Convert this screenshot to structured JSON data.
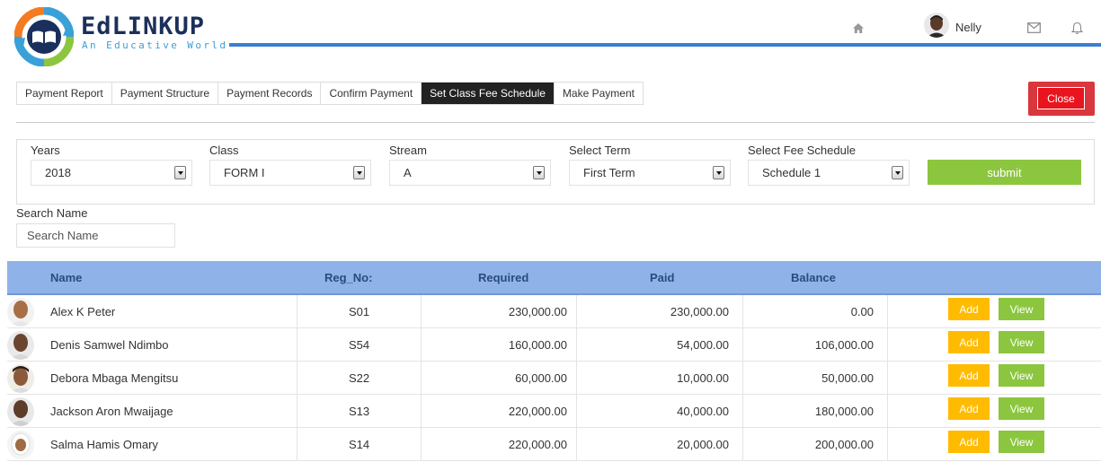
{
  "header": {
    "brand": "EdLINKUP",
    "tagline": "An Educative World",
    "user_name": "Nelly"
  },
  "tabs": [
    {
      "label": "Payment Report"
    },
    {
      "label": "Payment Structure"
    },
    {
      "label": "Payment Records"
    },
    {
      "label": "Confirm Payment"
    },
    {
      "label": "Set Class Fee Schedule",
      "active": true
    },
    {
      "label": "Make Payment"
    }
  ],
  "close_label": "Close",
  "filters": {
    "years": {
      "label": "Years",
      "value": "2018"
    },
    "class": {
      "label": "Class",
      "value": "FORM I"
    },
    "stream": {
      "label": "Stream",
      "value": "A"
    },
    "term": {
      "label": "Select Term",
      "value": "First Term"
    },
    "schedule": {
      "label": "Select Fee Schedule",
      "value": "Schedule 1"
    },
    "submit_label": "submit"
  },
  "search": {
    "label": "Search Name",
    "placeholder": "Search Name"
  },
  "table": {
    "columns": [
      "Name",
      "Reg_No:",
      "Required",
      "Paid",
      "Balance"
    ],
    "add_label": "Add",
    "view_label": "View",
    "rows": [
      {
        "name": "Alex K Peter",
        "reg_no": "S01",
        "required": "230,000.00",
        "paid": "230,000.00",
        "balance": "0.00"
      },
      {
        "name": "Denis Samwel Ndimbo",
        "reg_no": "S54",
        "required": "160,000.00",
        "paid": "54,000.00",
        "balance": "106,000.00"
      },
      {
        "name": "Debora Mbaga Mengitsu",
        "reg_no": "S22",
        "required": "60,000.00",
        "paid": "10,000.00",
        "balance": "50,000.00"
      },
      {
        "name": "Jackson Aron Mwaijage",
        "reg_no": "S13",
        "required": "220,000.00",
        "paid": "40,000.00",
        "balance": "180,000.00"
      },
      {
        "name": "Salma Hamis Omary",
        "reg_no": "S14",
        "required": "220,000.00",
        "paid": "20,000.00",
        "balance": "200,000.00"
      }
    ]
  },
  "colors": {
    "brand_navy": "#1b2f5c",
    "accent_blue": "#3b7fd1",
    "header_row": "#8fb3e8",
    "green_button": "#8cc63f",
    "add_button": "#ffbb00",
    "close_red": "#e8141e"
  },
  "icons": {
    "home": "home-icon",
    "mail": "mail-icon",
    "bell": "bell-icon",
    "logo": "book-cycle-logo"
  }
}
